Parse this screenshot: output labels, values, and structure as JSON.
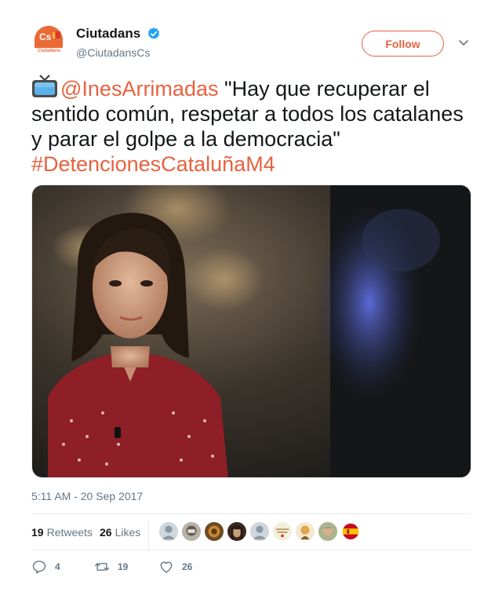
{
  "account": {
    "display_name": "Ciutadans",
    "handle": "@CiutadansCs",
    "verified": true,
    "avatar_logo_text": "Cs",
    "avatar_logo_subtext": "Ciutadans"
  },
  "follow_label": "Follow",
  "tweet": {
    "emoji": "tv-icon",
    "mention": "@InesArrimadas",
    "body": " \"Hay que recuperar el sentido común, respetar a todos los catalanes y parar el golpe a la democracia\" ",
    "hashtag": "#DetencionesCataluñaM4"
  },
  "timestamp": "5:11 AM - 20 Sep 2017",
  "stats": {
    "retweets_count": "19",
    "retweets_label": "Retweets",
    "likes_count": "26",
    "likes_label": "Likes"
  },
  "actions": {
    "reply_count": "4",
    "retweet_count": "19",
    "like_count": "26"
  },
  "colors": {
    "accent": "#e7623f",
    "verified": "#1da1f2",
    "text_primary": "#14171a",
    "text_secondary": "#657786"
  }
}
